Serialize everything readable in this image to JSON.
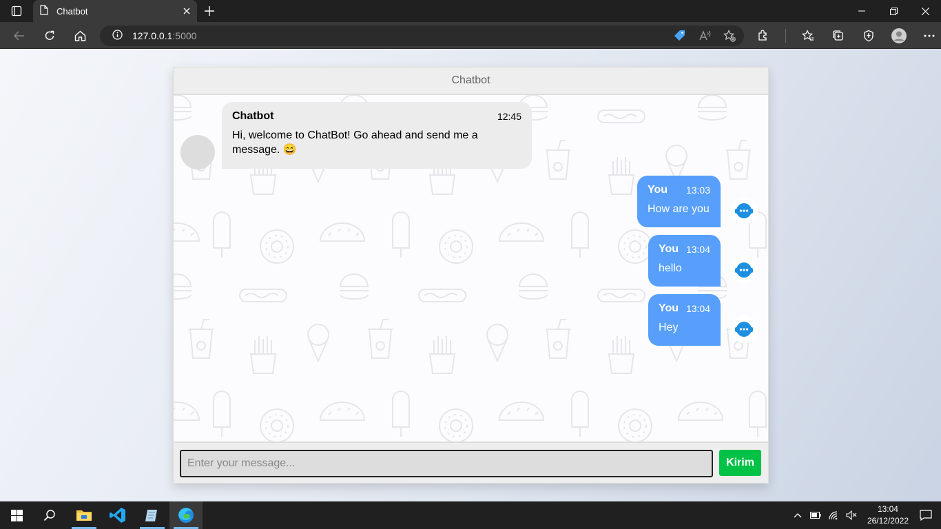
{
  "browser": {
    "tab_title": "Chatbot",
    "url_host": "127.0.0.1",
    "url_port": ":5000"
  },
  "chat": {
    "header_title": "Chatbot",
    "messages": [
      {
        "side": "left",
        "name": "Chatbot",
        "time": "12:45",
        "text": "Hi, welcome to ChatBot! Go ahead and send me a message. 😄"
      },
      {
        "side": "right",
        "name": "You",
        "time": "13:03",
        "text": "How are you"
      },
      {
        "side": "right",
        "name": "You",
        "time": "13:04",
        "text": "hello"
      },
      {
        "side": "right",
        "name": "You",
        "time": "13:04",
        "text": "Hey"
      }
    ],
    "input_placeholder": "Enter your message...",
    "send_label": "Kirim"
  },
  "taskbar": {
    "time": "13:04",
    "date": "26/12/2022"
  },
  "colors": {
    "user_bubble": "#579ffb",
    "bot_bubble": "#ececec",
    "send_button": "#00c246"
  }
}
